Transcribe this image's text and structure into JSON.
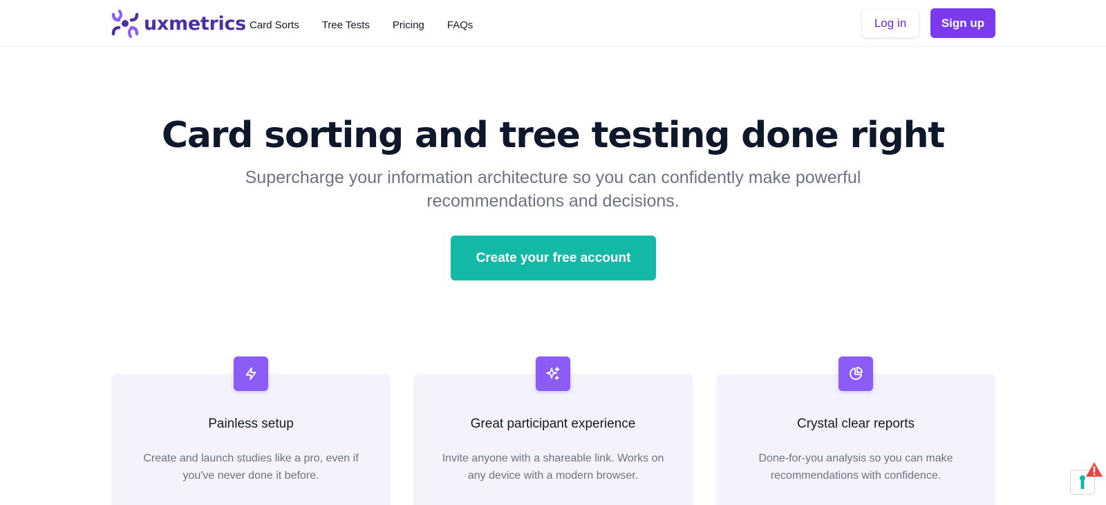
{
  "header": {
    "logo_text": "uxmetrics",
    "nav": [
      {
        "label": "Card Sorts"
      },
      {
        "label": "Tree Tests"
      },
      {
        "label": "Pricing"
      },
      {
        "label": "FAQs"
      }
    ],
    "login_label": "Log in",
    "signup_label": "Sign up"
  },
  "hero": {
    "title": "Card sorting and tree testing done right",
    "subtitle": "Supercharge your information architecture so you can confidently make powerful recommendations and decisions.",
    "cta_label": "Create your free account"
  },
  "features": [
    {
      "icon": "lightning-bolt-icon",
      "title": "Painless setup",
      "description": "Create and launch studies like a pro, even if you've never done it before."
    },
    {
      "icon": "sparkles-icon",
      "title": "Great participant experience",
      "description": "Invite anyone with a shareable link. Works on any device with a modern browser."
    },
    {
      "icon": "pie-chart-icon",
      "title": "Crystal clear reports",
      "description": "Done-for-you analysis so you can make recommendations with confidence."
    }
  ],
  "colors": {
    "brand": "#7c3aed",
    "cta": "#14b8a6",
    "card_bg": "#f4f2fd",
    "icon_bg": "#8b5cf6",
    "heading": "#0f172a",
    "muted": "#6b7280"
  }
}
